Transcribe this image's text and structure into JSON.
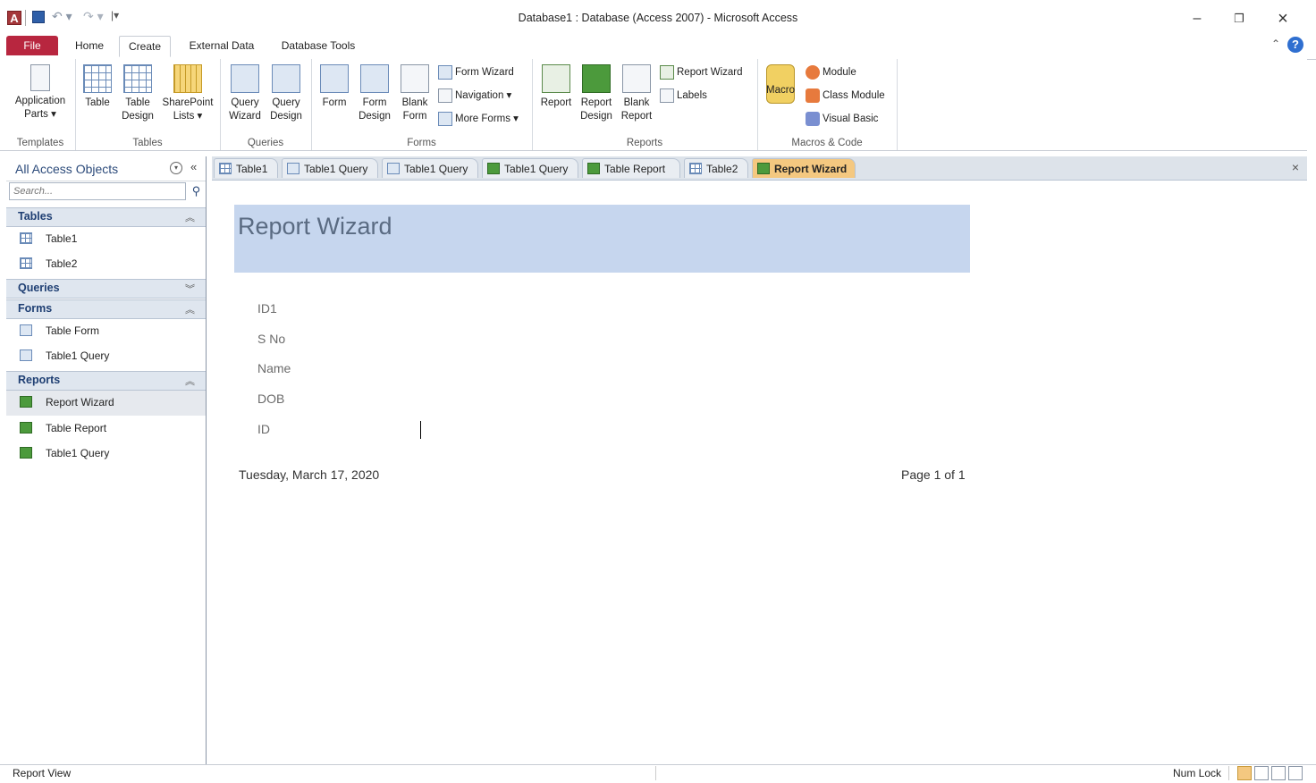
{
  "window": {
    "title": "Database1 : Database (Access 2007)  -  Microsoft Access",
    "logo_letter": "A",
    "minimize": "–",
    "restore": "❐",
    "close": "×",
    "help": "?",
    "collapse_ribbon": "⌃"
  },
  "ribbon_tabs": [
    "File",
    "Home",
    "Create",
    "External Data",
    "Database Tools"
  ],
  "ribbon": {
    "templates": {
      "label": "Templates",
      "application_parts": [
        "Application",
        "Parts ▾"
      ]
    },
    "tables": {
      "label": "Tables",
      "table": "Table",
      "table_design": [
        "Table",
        "Design"
      ],
      "sharepoint_lists": [
        "SharePoint",
        "Lists ▾"
      ]
    },
    "queries": {
      "label": "Queries",
      "query_wizard": [
        "Query",
        "Wizard"
      ],
      "query_design": [
        "Query",
        "Design"
      ]
    },
    "forms": {
      "label": "Forms",
      "form": "Form",
      "form_design": [
        "Form",
        "Design"
      ],
      "blank_form": [
        "Blank",
        "Form"
      ],
      "form_wizard": "Form Wizard",
      "navigation": "Navigation ▾",
      "more_forms": "More Forms ▾"
    },
    "reports": {
      "label": "Reports",
      "report": "Report",
      "report_design": [
        "Report",
        "Design"
      ],
      "blank_report": [
        "Blank",
        "Report"
      ],
      "report_wizard": "Report Wizard",
      "labels": "Labels"
    },
    "macros": {
      "label": "Macros & Code",
      "macro": "Macro",
      "module": "Module",
      "class_module": "Class Module",
      "visual_basic": "Visual Basic"
    }
  },
  "nav": {
    "title": "All Access Objects",
    "search_placeholder": "Search...",
    "groups": {
      "tables": {
        "title": "Tables",
        "items": [
          "Table1",
          "Table2"
        ]
      },
      "queries": {
        "title": "Queries"
      },
      "forms": {
        "title": "Forms",
        "items": [
          "Table Form",
          "Table1 Query"
        ]
      },
      "reports": {
        "title": "Reports",
        "items": [
          "Report Wizard",
          "Table Report",
          "Table1 Query"
        ]
      }
    }
  },
  "doc_tabs": [
    "Table1",
    "Table1 Query",
    "Table1 Query",
    "Table1 Query",
    "Table Report",
    "Table2",
    "Report Wizard"
  ],
  "report": {
    "title": "Report Wizard",
    "fields": [
      "ID1",
      "S No",
      "Name",
      "DOB",
      "ID"
    ],
    "date": "Tuesday, March 17, 2020",
    "page": "Page 1 of 1"
  },
  "status": {
    "left": "Report View",
    "num_lock": "Num Lock"
  }
}
